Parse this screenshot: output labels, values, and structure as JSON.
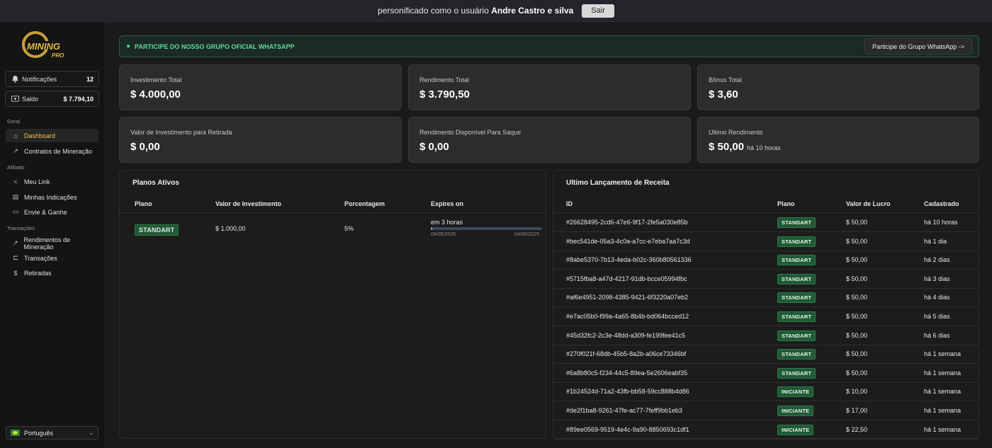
{
  "topbar": {
    "prefix": "personificado como o usuário",
    "user": "Andre Castro e silva",
    "exit_label": "Sair"
  },
  "sidebar": {
    "notifications_label": "Notificações",
    "notifications_count": "12",
    "balance_label": "Saldo",
    "balance_value": "$ 7.794,10",
    "sections": {
      "geral": "Geral",
      "afiliado": "Afiliado",
      "transacoes": "Transações"
    },
    "items": [
      {
        "label": "Dashboard",
        "icon": "home-icon"
      },
      {
        "label": "Contratos de Mineração",
        "icon": "trend-icon"
      },
      {
        "label": "Meu Link",
        "icon": "share-icon"
      },
      {
        "label": "Minhas Indicações",
        "icon": "list-icon"
      },
      {
        "label": "Envie & Ganhe",
        "icon": "video-icon"
      },
      {
        "label": "Rendimentos de Mineração",
        "icon": "trend-icon"
      },
      {
        "label": "Transações",
        "icon": "cart-icon"
      },
      {
        "label": "Retiradas",
        "icon": "coin-icon"
      }
    ],
    "language": "Português"
  },
  "banner": {
    "text": "PARTICIPE DO NOSSO GRUPO OFICIAL WHATSAPP",
    "button": "Participe do Grupo WhatsApp ->"
  },
  "cards": [
    {
      "label": "Investimento Total",
      "value": "$ 4.000,00",
      "sub": ""
    },
    {
      "label": "Rendimento Total",
      "value": "$ 3.790,50",
      "sub": ""
    },
    {
      "label": "Bônus Total",
      "value": "$ 3,60",
      "sub": ""
    },
    {
      "label": "Valor de Investimento para Retirada",
      "value": "$ 0,00",
      "sub": ""
    },
    {
      "label": "Rendimento Disponível Para Saque",
      "value": "$ 0,00",
      "sub": ""
    },
    {
      "label": "Ultimo Rendimento",
      "value": "$ 50,00",
      "sub": "há 10 horas"
    }
  ],
  "plans": {
    "title": "Planos Ativos",
    "headers": [
      "Plano",
      "Valor de Investimento",
      "Porcentagem",
      "Expires on"
    ],
    "row": {
      "plan": "STANDART",
      "value": "$ 1.000,00",
      "percent": "5%",
      "expires": "em 3 horas",
      "progress": 0.01,
      "start": "04/05/2025",
      "end": "04/05/2025"
    }
  },
  "revenue": {
    "title": "Ultimo Lançamento de Receita",
    "headers": [
      "ID",
      "Plano",
      "Valor de Lucro",
      "Cadastrado"
    ],
    "rows": [
      {
        "id": "#26628495-2cd6-47e6-9f17-2fe5a030e85b",
        "plan": "STANDART",
        "value": "$ 50,00",
        "date": "há 10 horas"
      },
      {
        "id": "#bec541de-05a3-4c0a-a7cc-e7eba7aa7c3d",
        "plan": "STANDART",
        "value": "$ 50,00",
        "date": "há 1 dia"
      },
      {
        "id": "#8abe5370-7b13-4eda-b02c-360b80561336",
        "plan": "STANDART",
        "value": "$ 50,00",
        "date": "há 2 dias"
      },
      {
        "id": "#5715fba8-a47d-4217-91db-bcce05994fbc",
        "plan": "STANDART",
        "value": "$ 50,00",
        "date": "há 3 dias"
      },
      {
        "id": "#af6e4951-2098-4385-9421-6f3220a07eb2",
        "plan": "STANDART",
        "value": "$ 50,00",
        "date": "há 4 dias"
      },
      {
        "id": "#e7ac05b0-f99a-4a65-8b4b-bd064bcced12",
        "plan": "STANDART",
        "value": "$ 50,00",
        "date": "há 5 dias"
      },
      {
        "id": "#45d32fc2-2c3e-48dd-a309-fe199fee41c5",
        "plan": "STANDART",
        "value": "$ 50,00",
        "date": "há 6 dias"
      },
      {
        "id": "#270f021f-68db-45b5-8a2b-a06ce73346bf",
        "plan": "STANDART",
        "value": "$ 50,00",
        "date": "há 1 semana"
      },
      {
        "id": "#6a8b80c5-f234-44c5-89ea-5e2606eabf35",
        "plan": "STANDART",
        "value": "$ 50,00",
        "date": "há 1 semana"
      },
      {
        "id": "#1b24524d-71a2-43fb-bb58-59cc888b4d86",
        "plan": "INICIANTE",
        "value": "$ 10,00",
        "date": "há 1 semana"
      },
      {
        "id": "#de2f1ba8-9261-47fe-ac77-7feff9bb1eb3",
        "plan": "INICIANTE",
        "value": "$ 17,00",
        "date": "há 1 semana"
      },
      {
        "id": "#89ee0569-9519-4e4c-9a90-8850693c1df1",
        "plan": "INICIANTE",
        "value": "$ 22,50",
        "date": "há 1 semana"
      }
    ]
  },
  "colors": {
    "accent": "#f2c14e",
    "badge": "#1f5a35",
    "whatsapp": "#4ad08a"
  }
}
